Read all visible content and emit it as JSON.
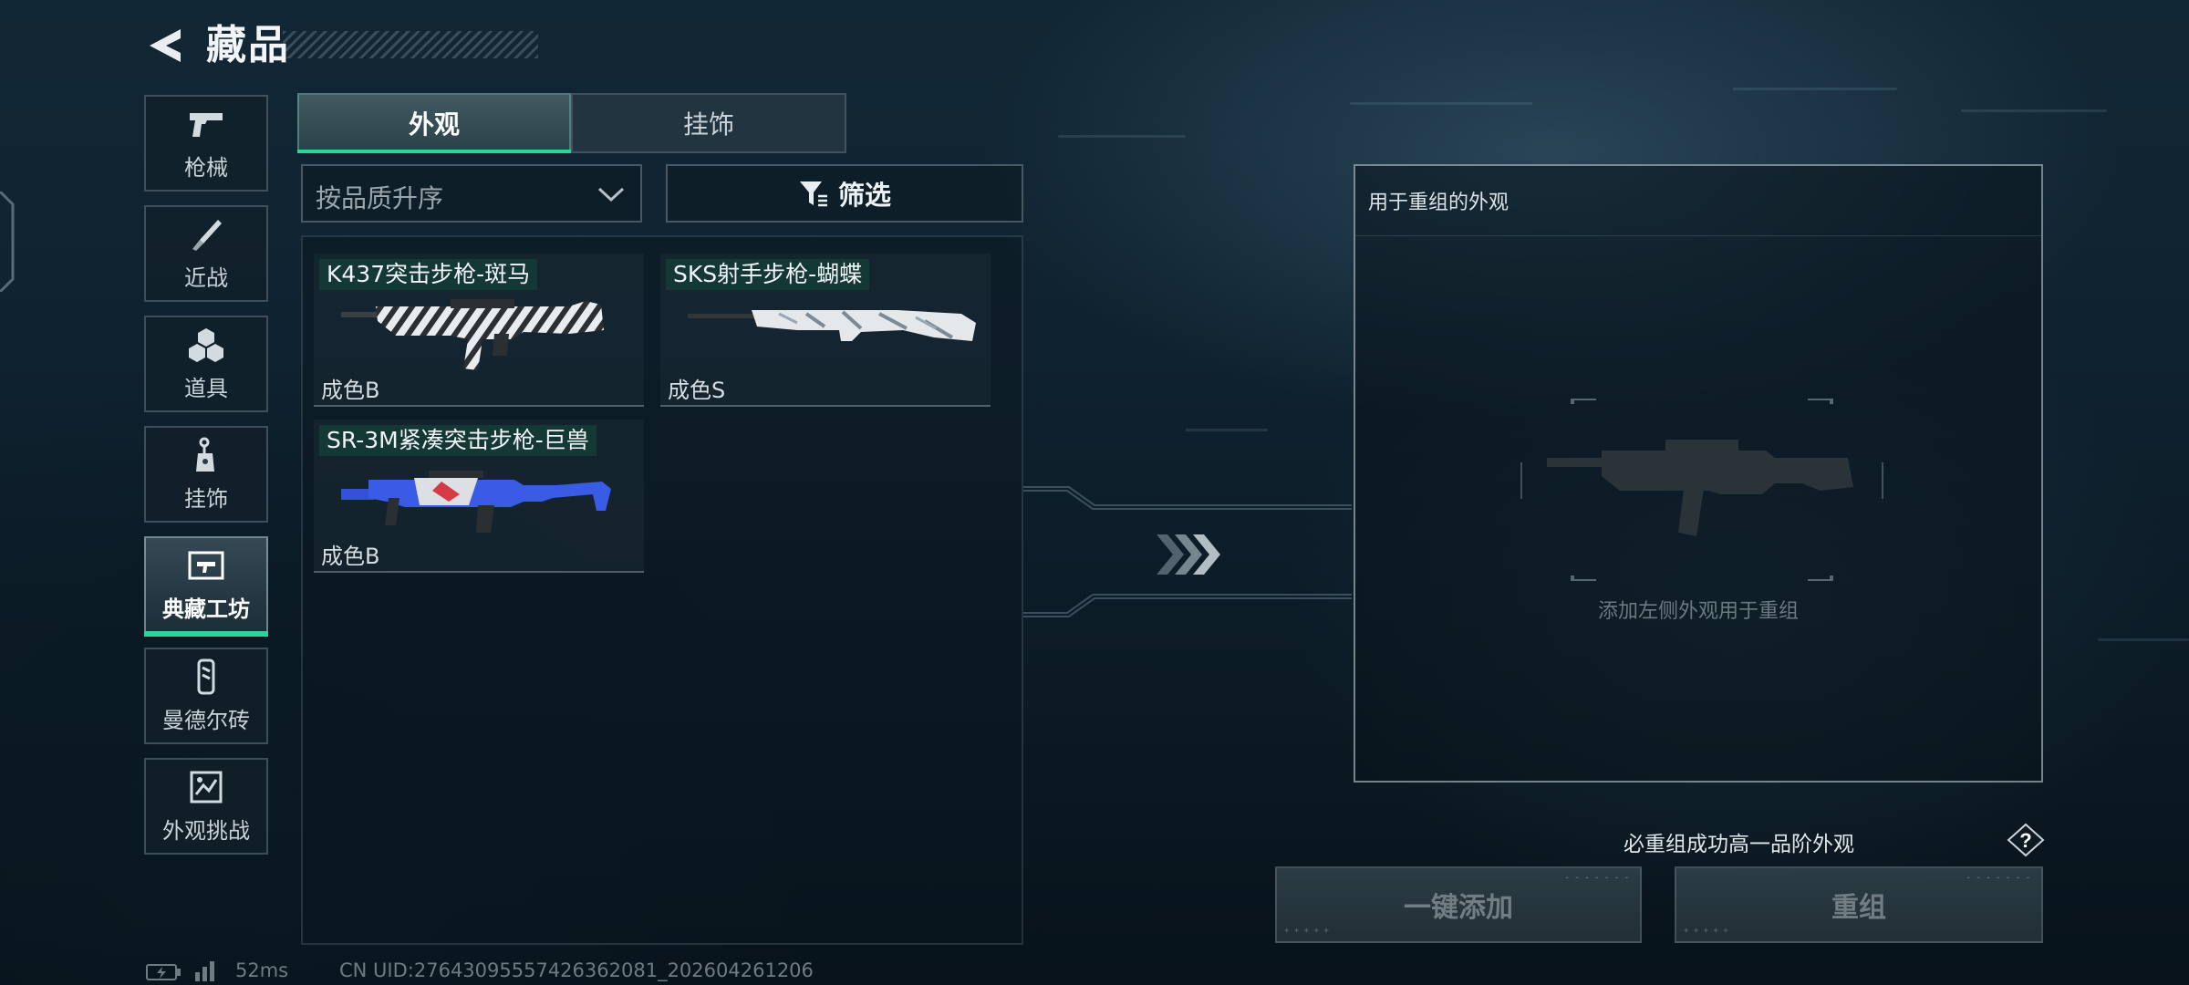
{
  "header": {
    "title": "藏品"
  },
  "sidebar": {
    "items": [
      {
        "label": "枪械",
        "icon": "gun-icon"
      },
      {
        "label": "近战",
        "icon": "knife-icon"
      },
      {
        "label": "道具",
        "icon": "grenade-icon"
      },
      {
        "label": "挂饰",
        "icon": "charm-icon"
      },
      {
        "label": "典藏工坊",
        "icon": "workshop-icon",
        "active": true
      },
      {
        "label": "曼德尔砖",
        "icon": "brick-icon"
      },
      {
        "label": "外观挑战",
        "icon": "challenge-icon"
      }
    ]
  },
  "tabs": [
    {
      "label": "外观",
      "active": true
    },
    {
      "label": "挂饰",
      "active": false
    }
  ],
  "sort": {
    "label": "按品质升序"
  },
  "filter": {
    "label": "筛选"
  },
  "items": [
    {
      "name": "K437突击步枪-斑马",
      "grade": "成色B"
    },
    {
      "name": "SKS射手步枪-蝴蝶",
      "grade": "成色S"
    },
    {
      "name": "SR-3M紧凑突击步枪-巨兽",
      "grade": "成色B"
    }
  ],
  "recombine": {
    "title": "用于重组的外观",
    "hint": "添加左侧外观用于重组",
    "guarantee": "必重组成功高一品阶外观",
    "one_click_label": "一键添加",
    "recombine_label": "重组"
  },
  "status": {
    "ping": "52ms",
    "uid": "CN UID:27643095557426362081_202604261206"
  },
  "colors": {
    "accent": "#2bd49b",
    "background": "#0f2230",
    "name_tag": "#143c34"
  }
}
